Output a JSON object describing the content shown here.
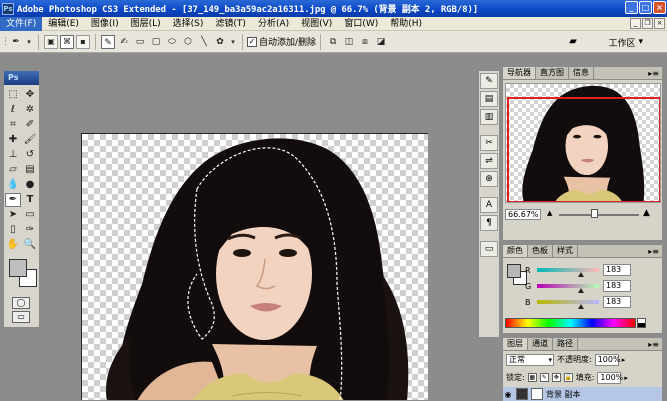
{
  "titlebar": {
    "app_icon_text": "Ps",
    "title": "Adobe Photoshop CS3 Extended - [37_149_ba3a59ac2a16311.jpg @ 66.7% (背景 副本 2, RGB/8)]",
    "buttons": [
      "_",
      "□",
      "×"
    ]
  },
  "menubar": {
    "items": [
      "文件(F)",
      "编辑(E)",
      "图像(I)",
      "图层(L)",
      "选择(S)",
      "滤镜(T)",
      "分析(A)",
      "视图(V)",
      "窗口(W)",
      "帮助(H)"
    ],
    "active_index": 0
  },
  "optionsbar": {
    "auto_add_delete_label": "自动添加/删除",
    "auto_add_delete_checked": true,
    "workspace_label": "工作区",
    "workspace_arrow": "▾"
  },
  "toolbox": {
    "logo": "Ps"
  },
  "navigator": {
    "tabs": [
      "导航器",
      "直方图",
      "信息"
    ],
    "active_tab": 0,
    "zoom": "66.67%"
  },
  "color": {
    "tabs": [
      "颜色",
      "色板",
      "样式"
    ],
    "active_tab": 0,
    "channels": [
      {
        "label": "R",
        "value": "183",
        "gradient_from": "#00b7b7",
        "gradient_to": "#ffb7b7"
      },
      {
        "label": "G",
        "value": "183",
        "gradient_from": "#b700b7",
        "gradient_to": "#b7ffb7"
      },
      {
        "label": "B",
        "value": "183",
        "gradient_from": "#b7b700",
        "gradient_to": "#b7b7ff"
      }
    ],
    "foreground": "#b7b7b7"
  },
  "layers": {
    "tabs": [
      "图层",
      "通道",
      "路径"
    ],
    "active_tab": 0,
    "blend_mode": "正常",
    "opacity_label": "不透明度:",
    "opacity_value": "100%",
    "lock_label": "锁定:",
    "fill_label": "填充:",
    "fill_value": "100%",
    "current_layer": "背景 副本"
  }
}
